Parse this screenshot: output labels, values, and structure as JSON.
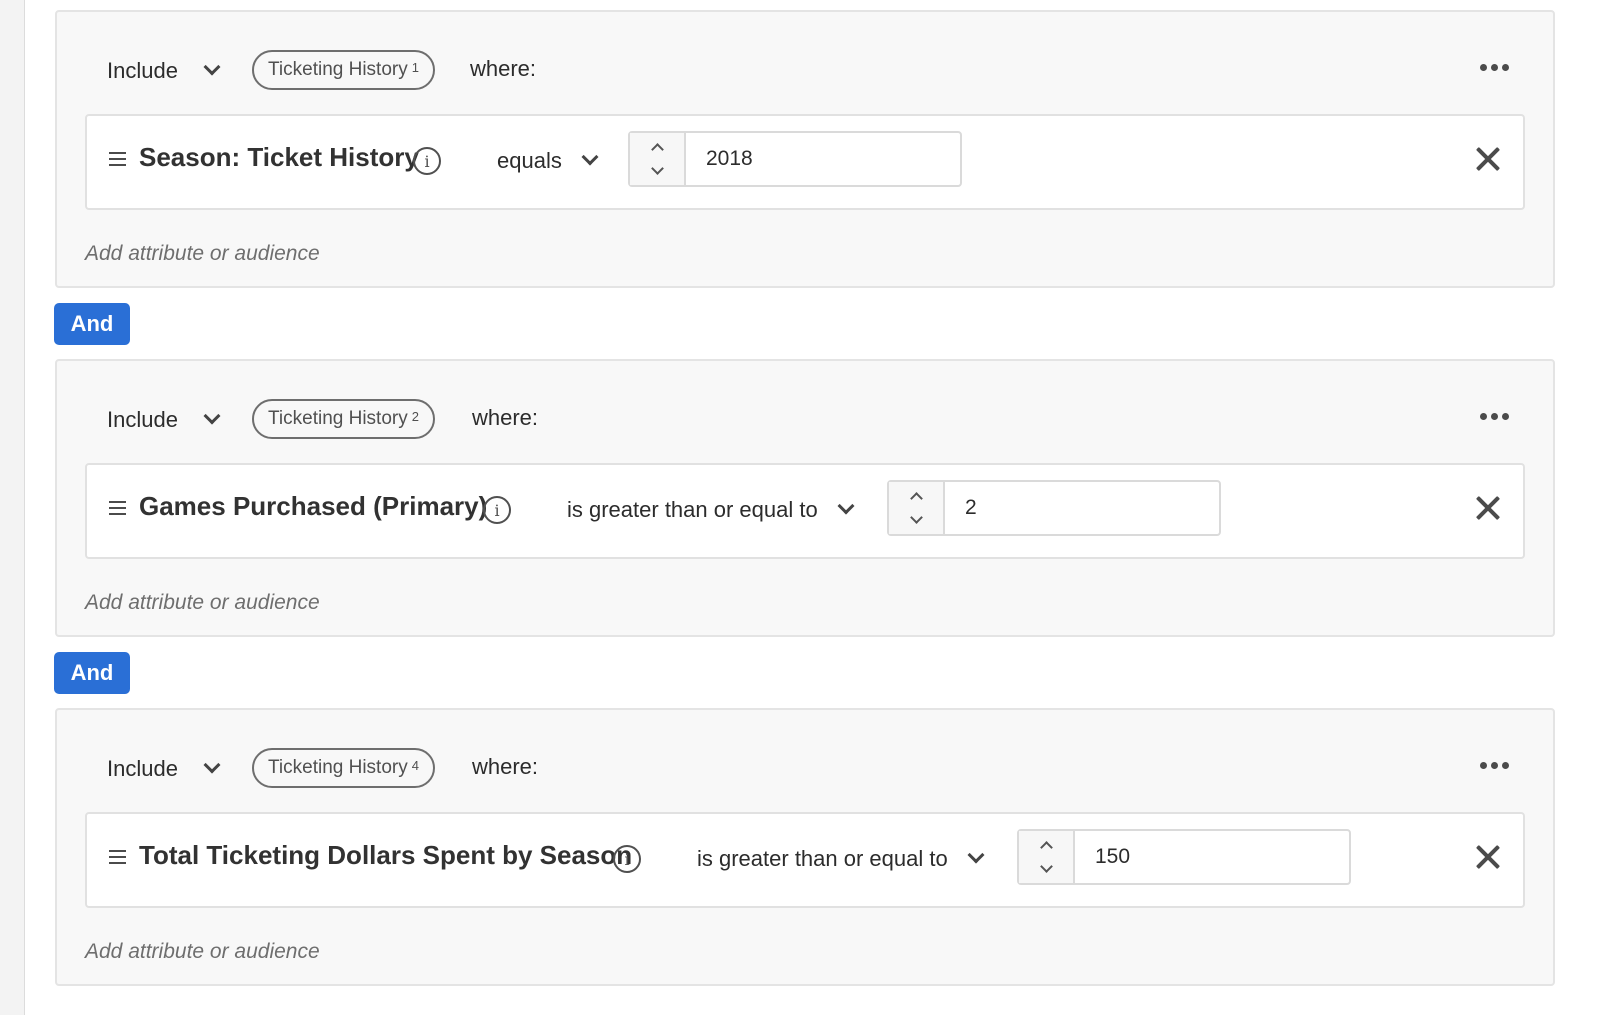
{
  "groups": [
    {
      "include_label": "Include",
      "dataset_label": "Ticketing History",
      "dataset_sup": "1",
      "where_label": "where:",
      "attribute": "Season: Ticket History",
      "operator": "equals",
      "value": "2018",
      "add_label": "Add attribute or audience"
    },
    {
      "include_label": "Include",
      "dataset_label": "Ticketing History",
      "dataset_sup": "2",
      "where_label": "where:",
      "attribute": "Games Purchased (Primary)",
      "operator": "is greater than or equal to",
      "value": "2",
      "add_label": "Add attribute or audience"
    },
    {
      "include_label": "Include",
      "dataset_label": "Ticketing History",
      "dataset_sup": "4",
      "where_label": "where:",
      "attribute": "Total Ticketing Dollars Spent by Season",
      "operator": "is greater than or equal to",
      "value": "150",
      "add_label": "Add attribute or audience"
    }
  ],
  "connectors": [
    {
      "label": "And"
    },
    {
      "label": "And"
    }
  ],
  "icons": {
    "info": "i",
    "more": "more-horizontal-icon",
    "close": "close-icon",
    "drag": "drag-handle-icon"
  },
  "colors": {
    "accent": "#2a6fd6",
    "group_bg": "#f8f8f8",
    "border": "#e4e4e4"
  }
}
